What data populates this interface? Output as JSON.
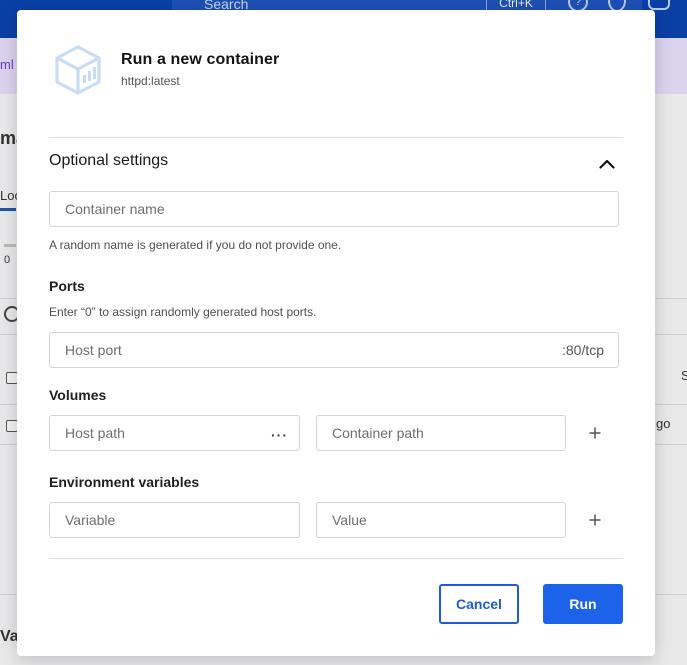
{
  "background": {
    "search_placeholder": "Search",
    "search_shortcut": "Ctrl+K",
    "help_glyph": "?",
    "band_text": "ml",
    "heading": "ma",
    "tab_label": "Loc",
    "small_value": "0",
    "column_letter": "S",
    "row_suffix": "go",
    "bottom_text": "Val"
  },
  "modal": {
    "title": "Run a new container",
    "subtitle": "httpd:latest",
    "header_icon": "container-box-icon"
  },
  "optional_settings": {
    "title": "Optional settings",
    "toggle_icon": "chevron-up-icon",
    "container_name": {
      "placeholder": "Container name",
      "value": "",
      "hint": "A random name is generated if you do not provide one."
    },
    "ports": {
      "label": "Ports",
      "hint": "Enter “0” to assign randomly generated host ports.",
      "host_port_placeholder": "Host port",
      "container_port_suffix": ":80/tcp"
    },
    "volumes": {
      "label": "Volumes",
      "host_path_placeholder": "Host path",
      "browse_icon": "more-dots-icon",
      "browse_glyph": "···",
      "container_path_placeholder": "Container path",
      "add_icon": "plus-icon"
    },
    "environment": {
      "label": "Environment variables",
      "variable_placeholder": "Variable",
      "value_placeholder": "Value",
      "add_icon": "plus-icon"
    }
  },
  "footer": {
    "cancel_label": "Cancel",
    "run_label": "Run"
  },
  "colors": {
    "primary": "#1d63ea",
    "cancel_border": "#1d5bd8",
    "icon_tint": "#c9dcf5"
  }
}
